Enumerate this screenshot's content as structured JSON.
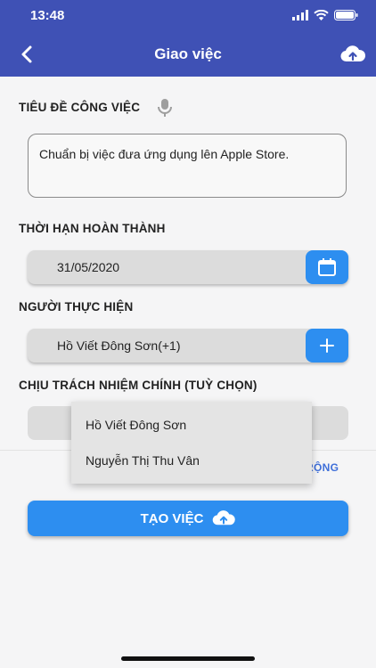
{
  "status_bar": {
    "time": "13:48"
  },
  "nav": {
    "title": "Giao việc",
    "back_icon": "chevron-left-icon",
    "upload_icon": "cloud-upload-icon"
  },
  "task_title": {
    "label": "TIÊU ĐỀ CÔNG VIỆC",
    "mic_icon": "microphone-icon",
    "value": "Chuẩn bị việc đưa ứng dụng lên Apple Store."
  },
  "deadline": {
    "label": "THỜI HẠN HOÀN THÀNH",
    "value": "31/05/2020",
    "button_icon": "calendar-icon"
  },
  "assignees": {
    "label": "NGƯỜI THỰC HIỆN",
    "value": "Hồ Viết Đông Sơn(+1)",
    "button_icon": "plus-icon"
  },
  "main_responsible": {
    "label": "CHỊU TRÁCH NHIỆM CHÍNH (TUỲ CHỌN)",
    "options": [
      "Hồ Viết Đông Sơn",
      "Nguyễn Thị Thu Vân"
    ]
  },
  "expand_link": "RỘNG",
  "create_button": {
    "label": "TẠO VIỆC",
    "icon": "cloud-upload-icon"
  },
  "colors": {
    "primary": "#3f51b5",
    "accent": "#2d8ef0",
    "field_bg": "#dcdcdc"
  }
}
